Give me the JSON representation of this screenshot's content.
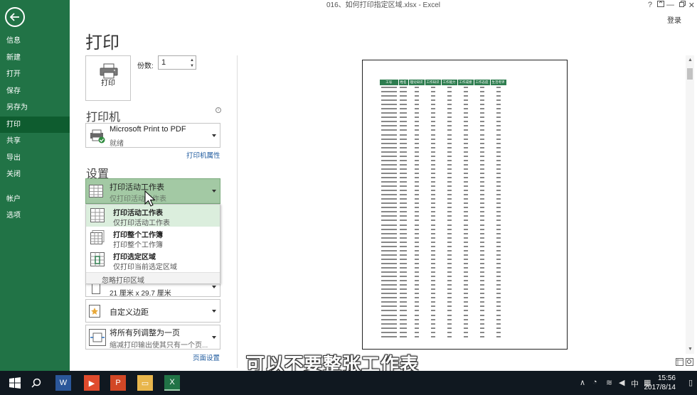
{
  "window": {
    "title": "016、如何打印指定区域.xlsx - Excel",
    "help": "?",
    "login": "登录"
  },
  "nav": {
    "items": [
      "信息",
      "新建",
      "打开",
      "保存",
      "另存为",
      "打印",
      "共享",
      "导出",
      "关闭"
    ],
    "items2": [
      "帐户",
      "选项"
    ],
    "active": "打印"
  },
  "print": {
    "page_title": "打印",
    "print_button_label": "打印",
    "copies_label": "份数:",
    "copies_value": "1"
  },
  "printer": {
    "header": "打印机",
    "name": "Microsoft Print to PDF",
    "status": "就绪",
    "properties_link": "打印机属性"
  },
  "settings": {
    "header": "设置",
    "scope_title": "打印活动工作表",
    "scope_sub": "仅打印活动工作表",
    "menu": [
      {
        "title": "打印活动工作表",
        "sub": "仅打印活动工作表"
      },
      {
        "title": "打印整个工作簿",
        "sub": "打印整个工作簿"
      },
      {
        "title": "打印选定区域",
        "sub": "仅打印当前选定区域"
      }
    ],
    "ignore_area": "忽略打印区域",
    "paper": "21 厘米 x 29.7 厘米",
    "margins": "自定义边距",
    "scaling_title": "将所有列调整为一页",
    "scaling_sub": "缩减打印输出使其只有一个页...",
    "page_setup_link": "页面设置"
  },
  "preview": {
    "headers": [
      "工号",
      "姓名",
      "理论知识",
      "工作知识",
      "工作能力",
      "工作成绩",
      "工作态度",
      "生活考评"
    ]
  },
  "caption": "可以不要整张工作表",
  "taskbar": {
    "time": "15:56",
    "date": "2017/8/14",
    "ime": "中"
  },
  "colors": {
    "nav_bg": "#217346",
    "nav_active": "#0e5c2f",
    "accent_link": "#1e5a9e",
    "selected_dropdown": "#a3c9a4"
  }
}
